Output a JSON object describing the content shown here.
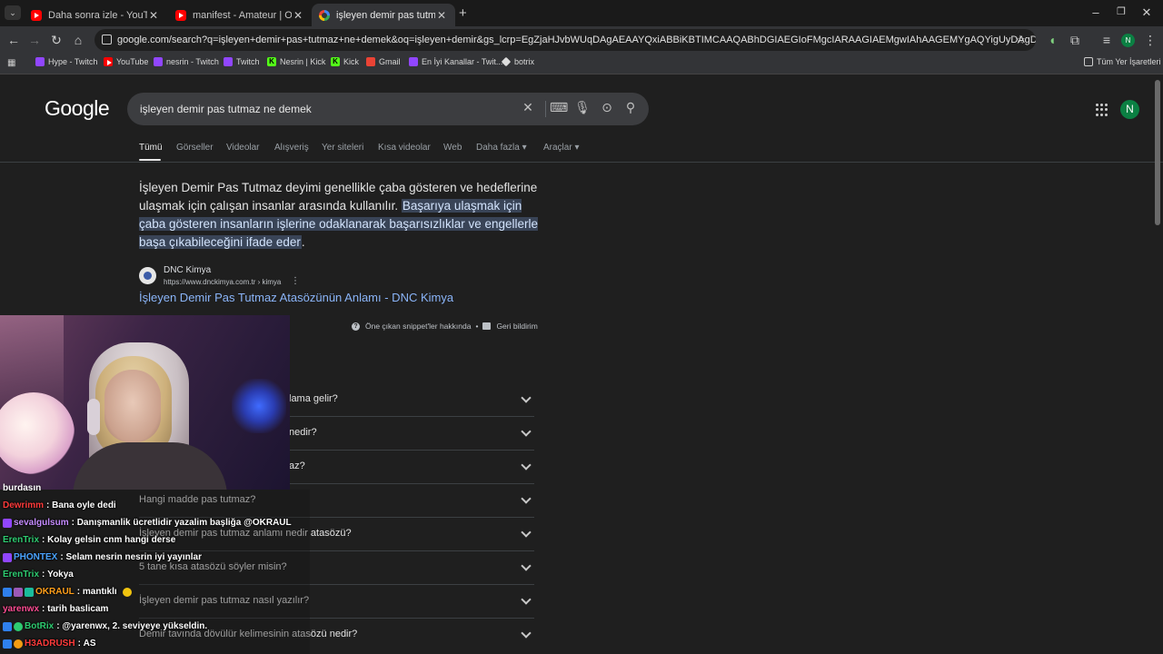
{
  "browser": {
    "tabs": [
      {
        "title": "Daha sonra izle - YouTube",
        "icon": "youtube-icon"
      },
      {
        "title": "manifest - Amateur | Official M...",
        "icon": "youtube-icon"
      },
      {
        "title": "işleyen demir pas tutmaz ne de...",
        "icon": "google-icon"
      }
    ],
    "url": "google.com/search?q=işleyen+demir+pas+tutmaz+ne+demek&oq=işleyen+demir&gs_lcrp=EgZjaHJvbWUqDAgAEAAYQxiABBiKBTIMCAAQABhDGIAEGIoFMgcIARAAGIAEMgwIAhAAGEMYgAQYigUyDAgDEAAYQxiABBiKBTIHCAQQABiAB...",
    "bookmarks": [
      {
        "label": "Hype - Twitch",
        "icon": "twitch-icon"
      },
      {
        "label": "YouTube",
        "icon": "youtube-icon"
      },
      {
        "label": "nesrin - Twitch",
        "icon": "twitch-icon"
      },
      {
        "label": "Twitch",
        "icon": "twitch-icon"
      },
      {
        "label": "Nesrin | Kick",
        "icon": "kick-icon"
      },
      {
        "label": "Kick",
        "icon": "kick-icon"
      },
      {
        "label": "Gmail",
        "icon": "gmail-icon"
      },
      {
        "label": "En İyi Kanallar - Twit...",
        "icon": "twitch-icon"
      },
      {
        "label": "botrix",
        "icon": "botrix-icon"
      }
    ],
    "all_bookmarks": "Tüm Yer İşaretleri",
    "profile_initial": "N"
  },
  "google": {
    "logo": "Google",
    "query": "işleyen demir pas tutmaz ne demek",
    "avatar": "N",
    "tabs": [
      "Tümü",
      "Görseller",
      "Videolar",
      "Alışveriş",
      "Yer siteleri",
      "Kısa videolar",
      "Web",
      "Daha fazla ▾",
      "Araçlar ▾"
    ],
    "snippet_plain": "İşleyen Demir Pas Tutmaz deyimi genellikle çaba gösteren ve hedeflerine ulaşmak için çalışan insanlar arasında kullanılır. ",
    "snippet_highlight": "Başarıya ulaşmak için çaba gösteren insanların işlerine odaklanarak başarısızlıklar ve engellerle başa çıkabileceğini ifade eder",
    "snippet_end": ".",
    "source_name": "DNC Kimya",
    "source_url": "https://www.dnckimya.com.tr › kimya",
    "result_title": "İşleyen Demir Pas Tutmaz Atasözünün Anlamı - DNC Kimya",
    "feedback_about": "Öne çıkan snippet'ler hakkında",
    "feedback_send": "Geri bildirim",
    "faq": [
      "lama gelir?",
      "nedir?",
      "az?",
      "Hangi madde pas tutmaz?",
      "İşleyen demir pas tutmaz anlamı nedir atasözü?",
      "5 tane kısa atasözü söyler misin?",
      "İşleyen demir pas tutmaz nasıl yazılır?",
      "Demir tavında dövülür kelimesinin atasözü nedir?"
    ]
  },
  "chat": {
    "cut_line": "burdasın",
    "messages": [
      {
        "user": "Dewrimm",
        "text": "Bana oyle dedi",
        "color": "#ff3b3b"
      },
      {
        "user": "sevalgulsum",
        "text": "Danışmanlik ücretlidir yazalim başliğa @OKRAUL",
        "color": "#c58cff"
      },
      {
        "user": "ErenTrix",
        "text": "Kolay gelsin cnm hangi derse",
        "color": "#2ecc71"
      },
      {
        "user": "PHONTEX",
        "text": "Selam nesrin nesrin iyi yayınlar",
        "color": "#4aa3ff"
      },
      {
        "user": "ErenTrix",
        "text": "Yokya",
        "color": "#2ecc71"
      },
      {
        "user": "OKRAUL",
        "text": "mantıklı",
        "color": "#ff9f1a"
      },
      {
        "user": "yarenwx",
        "text": "tarih baslicam",
        "color": "#ff4d94"
      },
      {
        "user": "BotRix",
        "text": "@yarenwx, 2. seviyeye yükseldin.",
        "color": "#2ecc71"
      },
      {
        "user": "H3ADRUSH",
        "text": "AS",
        "color": "#ff3b3b"
      }
    ]
  }
}
